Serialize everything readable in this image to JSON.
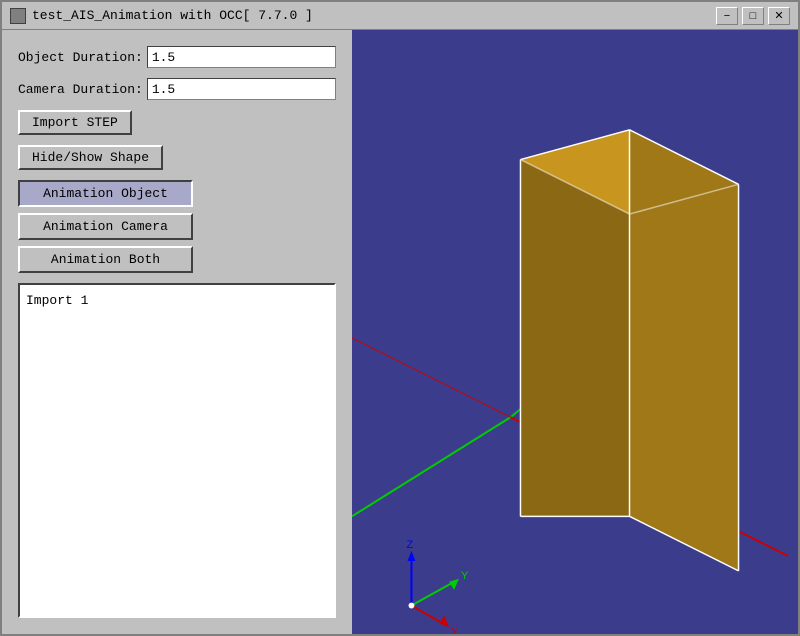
{
  "window": {
    "title": "test_AIS_Animation with OCC[ 7.7.0 ]",
    "icon": "app-icon"
  },
  "titlebar": {
    "minimize_label": "−",
    "maximize_label": "□",
    "close_label": "✕"
  },
  "controls": {
    "object_duration_label": "Object Duration:",
    "object_duration_value": "1.5",
    "camera_duration_label": "Camera Duration:",
    "camera_duration_value": "1.5",
    "import_step_label": "Import STEP",
    "hide_show_label": "Hide/Show Shape",
    "anim_object_label": "Animation Object",
    "anim_camera_label": "Animation Camera",
    "anim_both_label": "Animation Both"
  },
  "listbox": {
    "items": [
      "Import 1"
    ]
  },
  "viewport": {
    "background_color": "#3c3c8c"
  },
  "axes": {
    "x_label": "X",
    "y_label": "Y",
    "z_label": "Z"
  }
}
